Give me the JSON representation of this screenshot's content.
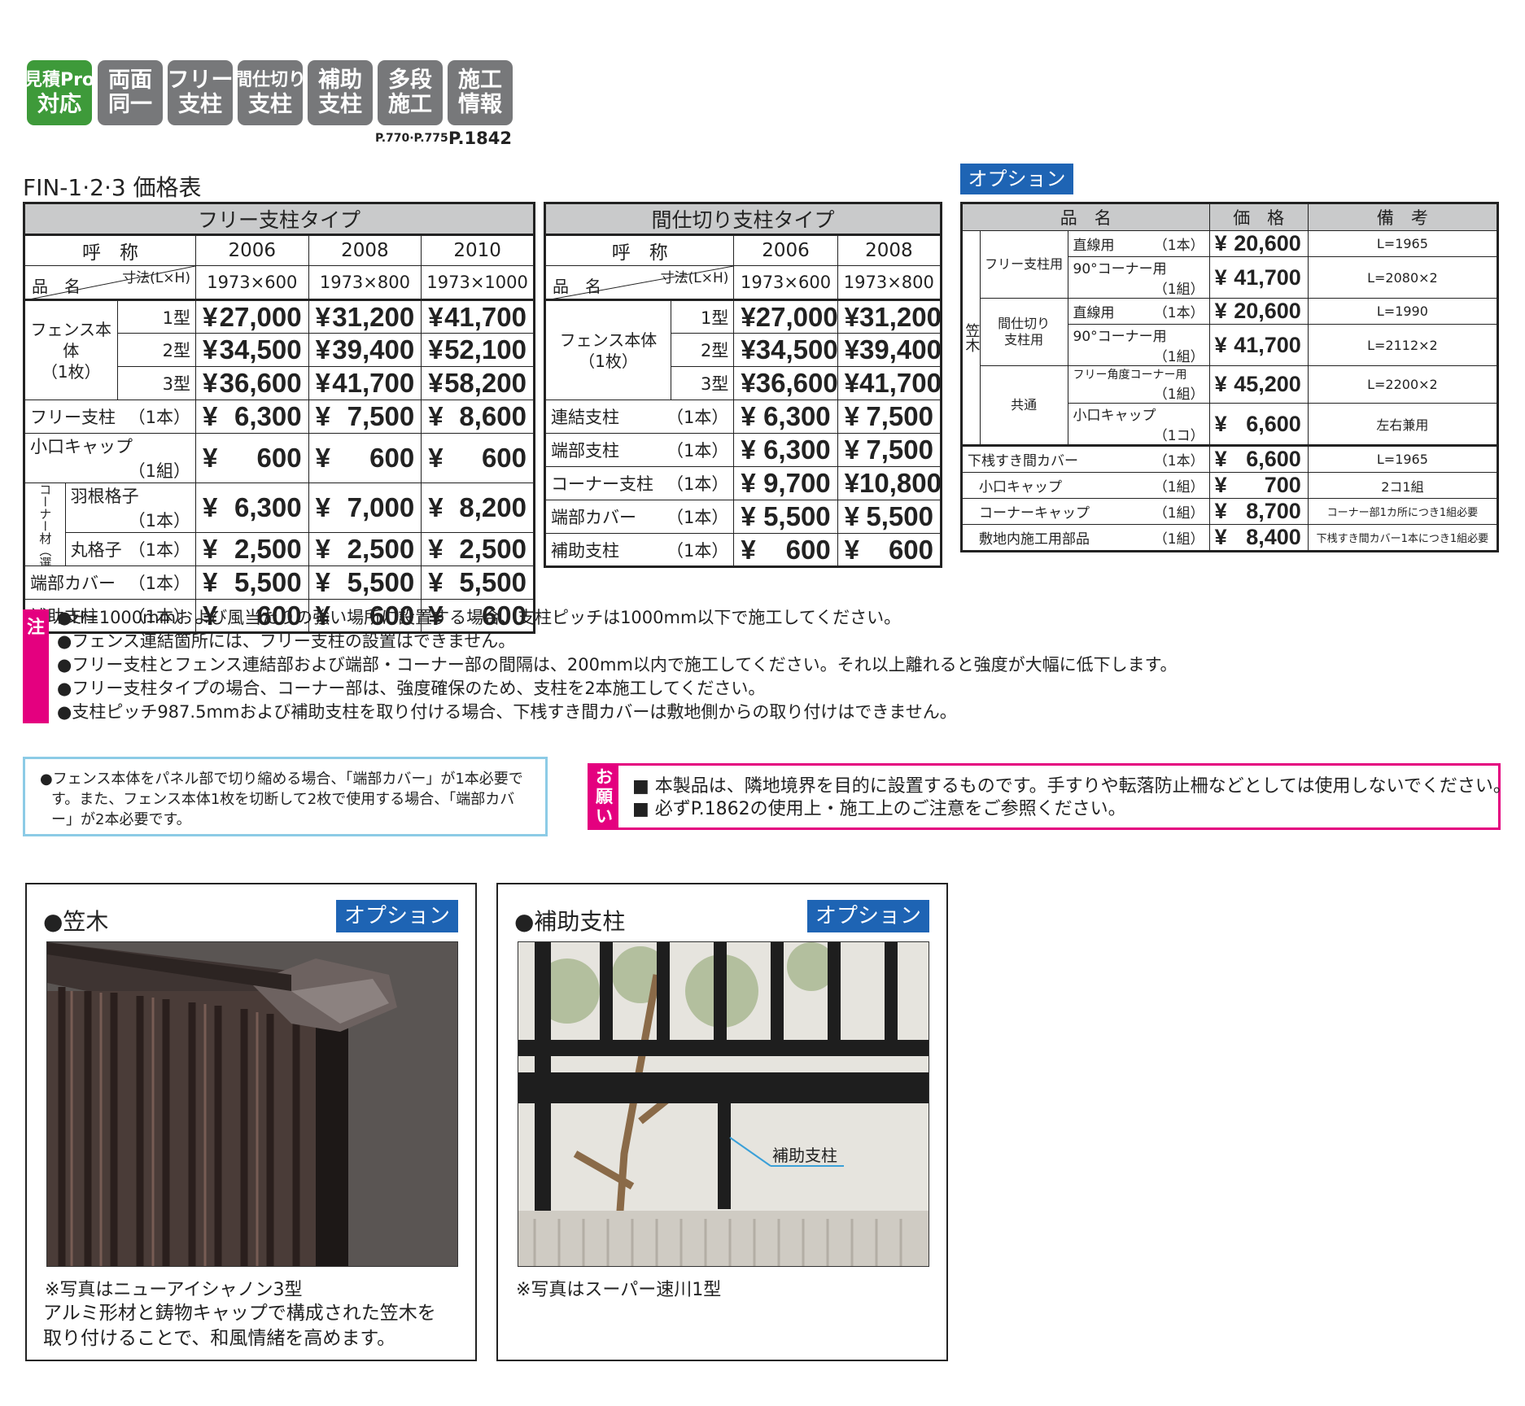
{
  "badges": [
    {
      "lines": [
        "見積Pro",
        "対応"
      ],
      "color": "#3e9a3a"
    },
    {
      "lines": [
        "両面",
        "同一"
      ],
      "color": "#77787a"
    },
    {
      "lines": [
        "フリー",
        "支柱"
      ],
      "color": "#77787a"
    },
    {
      "lines": [
        "間仕切り",
        "支柱"
      ],
      "color": "#77787a"
    },
    {
      "lines": [
        "補助",
        "支柱"
      ],
      "color": "#77787a"
    },
    {
      "lines": [
        "多段",
        "施工"
      ],
      "color": "#77787a"
    },
    {
      "lines": [
        "施工",
        "情報"
      ],
      "color": "#77787a"
    }
  ],
  "page_refs": {
    "small": "P.770·P.775",
    "large": "P.1842"
  },
  "title": "FIN-1·2·3 価格表",
  "free_table": {
    "title": "フリー支柱タイプ",
    "name_header": "呼　称",
    "dim_header": "寸法(L×H)",
    "item_header": "品　名",
    "codes": [
      "2006",
      "2008",
      "2010"
    ],
    "dims": [
      "1973×600",
      "1973×800",
      "1973×1000"
    ],
    "body_label": "フェンス本体\n（1枚）",
    "body_rows": [
      {
        "type": "1型",
        "prices": [
          "27,000",
          "31,200",
          "41,700"
        ]
      },
      {
        "type": "2型",
        "prices": [
          "34,500",
          "39,400",
          "52,100"
        ]
      },
      {
        "type": "3型",
        "prices": [
          "36,600",
          "41,700",
          "58,200"
        ]
      }
    ],
    "rows": [
      {
        "name": "フリー支柱",
        "unit": "（1本）",
        "prices": [
          "6,300",
          "7,500",
          "8,600"
        ]
      },
      {
        "name": "小口キャップ",
        "unit": "（1組）",
        "prices": [
          "600",
          "600",
          "600"
        ]
      }
    ],
    "corner_label": "コーナー材（選択）",
    "corner_rows": [
      {
        "name": "羽根格子",
        "unit": "（1本）",
        "prices": [
          "6,300",
          "7,000",
          "8,200"
        ]
      },
      {
        "name": "丸格子",
        "unit": "（1本）",
        "prices": [
          "2,500",
          "2,500",
          "2,500"
        ]
      }
    ],
    "tail_rows": [
      {
        "name": "端部カバー",
        "unit": "（1本）",
        "prices": [
          "5,500",
          "5,500",
          "5,500"
        ]
      },
      {
        "name": "補助支柱",
        "unit": "（1本）",
        "prices": [
          "600",
          "600",
          "600"
        ]
      }
    ]
  },
  "partition_table": {
    "title": "間仕切り支柱タイプ",
    "name_header": "呼　称",
    "dim_header": "寸法(L×H)",
    "item_header": "品　名",
    "codes": [
      "2006",
      "2008"
    ],
    "dims": [
      "1973×600",
      "1973×800"
    ],
    "body_label": "フェンス本体\n（1枚）",
    "body_rows": [
      {
        "type": "1型",
        "prices": [
          "27,000",
          "31,200"
        ]
      },
      {
        "type": "2型",
        "prices": [
          "34,500",
          "39,400"
        ]
      },
      {
        "type": "3型",
        "prices": [
          "36,600",
          "41,700"
        ]
      }
    ],
    "rows": [
      {
        "name": "連結支柱",
        "unit": "（1本）",
        "prices": [
          "6,300",
          "7,500"
        ]
      },
      {
        "name": "端部支柱",
        "unit": "（1本）",
        "prices": [
          "6,300",
          "7,500"
        ]
      },
      {
        "name": "コーナー支柱",
        "unit": "（1本）",
        "prices": [
          "9,700",
          "10,800"
        ]
      },
      {
        "name": "端部カバー",
        "unit": "（1本）",
        "prices": [
          "5,500",
          "5,500"
        ]
      },
      {
        "name": "補助支柱",
        "unit": "（1本）",
        "prices": [
          "600",
          "600"
        ]
      }
    ]
  },
  "yen": "¥",
  "option_tag": "オプション",
  "option_table": {
    "headers": [
      "品　名",
      "価　格",
      "備　考"
    ],
    "kasagi_label": "笠木",
    "groups": [
      {
        "label": "フリー支柱用",
        "rows": [
          {
            "name": "直線用",
            "unit": "（1本）",
            "price": "20,600",
            "note": "L=1965"
          },
          {
            "name": "90°コーナー用",
            "unit": "（1組）",
            "price": "41,700",
            "note": "L=2080×2"
          }
        ]
      },
      {
        "label": "間仕切り\n支柱用",
        "rows": [
          {
            "name": "直線用",
            "unit": "（1本）",
            "price": "20,600",
            "note": "L=1990"
          },
          {
            "name": "90°コーナー用",
            "unit": "（1組）",
            "price": "41,700",
            "note": "L=2112×2"
          }
        ]
      },
      {
        "label": "共通",
        "rows": [
          {
            "name": "フリー角度コーナー用",
            "unit": "（1組）",
            "price": "45,200",
            "note": "L=2200×2"
          },
          {
            "name": "小口キャップ",
            "unit": "（1コ）",
            "price": "6,600",
            "note": "左右兼用"
          }
        ]
      }
    ],
    "lower": [
      {
        "name": "下桟すき間カバー",
        "unit": "（1本）",
        "price": "6,600",
        "note": "L=1965"
      },
      {
        "name": "小口キャップ",
        "unit": "（1組）",
        "price": "700",
        "note": "2コ1組"
      },
      {
        "name": "コーナーキャップ",
        "unit": "（1組）",
        "price": "8,700",
        "note": "コーナー部1カ所につき1組必要"
      },
      {
        "name": "敷地内施工用部品",
        "unit": "（1組）",
        "price": "8,400",
        "note": "下桟すき間カバー1本につき1組必要"
      }
    ]
  },
  "caution_label": "注",
  "cautions": [
    "●H=1000mmおよび風当たりの強い場所に設置する場合、支柱ピッチは1000mm以下で施工してください。",
    "●フェンス連結箇所には、フリー支柱の設置はできません。",
    "●フリー支柱とフェンス連結部および端部・コーナー部の間隔は、200mm以内で施工してください。それ以上離れると強度が大幅に低下します。",
    "●フリー支柱タイプの場合、コーナー部は、強度確保のため、支柱を2本施工してください。",
    "●支柱ピッチ987.5mmおよび補助支柱を取り付ける場合、下桟すき間カバーは敷地側からの取り付けはできません。"
  ],
  "info_box": [
    "●フェンス本体をパネル部で切り縮める場合、「端部カバー」が1本必要で",
    "す。また、フェンス本体1枚を切断して2枚で使用する場合、「端部カバ",
    "ー」が2本必要です。"
  ],
  "request_label": [
    "お",
    "願",
    "い"
  ],
  "requests": [
    "■ 本製品は、隣地境界を目的に設置するものです。手すりや転落防止柵などとしては使用しないでください。",
    "■ 必ずP.1862の使用上・施工上のご注意をご参照ください。"
  ],
  "kasagi_panel": {
    "heading": "●笠木",
    "tag": "オプション",
    "photo_note": "※写真はニューアイシャノン3型",
    "desc": [
      "アルミ形材と鋳物キャップで構成された笠木を",
      "取り付けることで、和風情緒を高めます。"
    ]
  },
  "hojo_panel": {
    "heading": "●補助支柱",
    "tag": "オプション",
    "callout": "補助支柱",
    "photo_note": "※写真はスーパー速川1型"
  },
  "colors": {
    "badge_green": "#3e9a3a",
    "badge_grey": "#77787a",
    "option_blue": "#1e64b4",
    "caution_pink": "#e4007f",
    "info_border": "#8ccbe6",
    "header_grey": "#c9cacb"
  }
}
